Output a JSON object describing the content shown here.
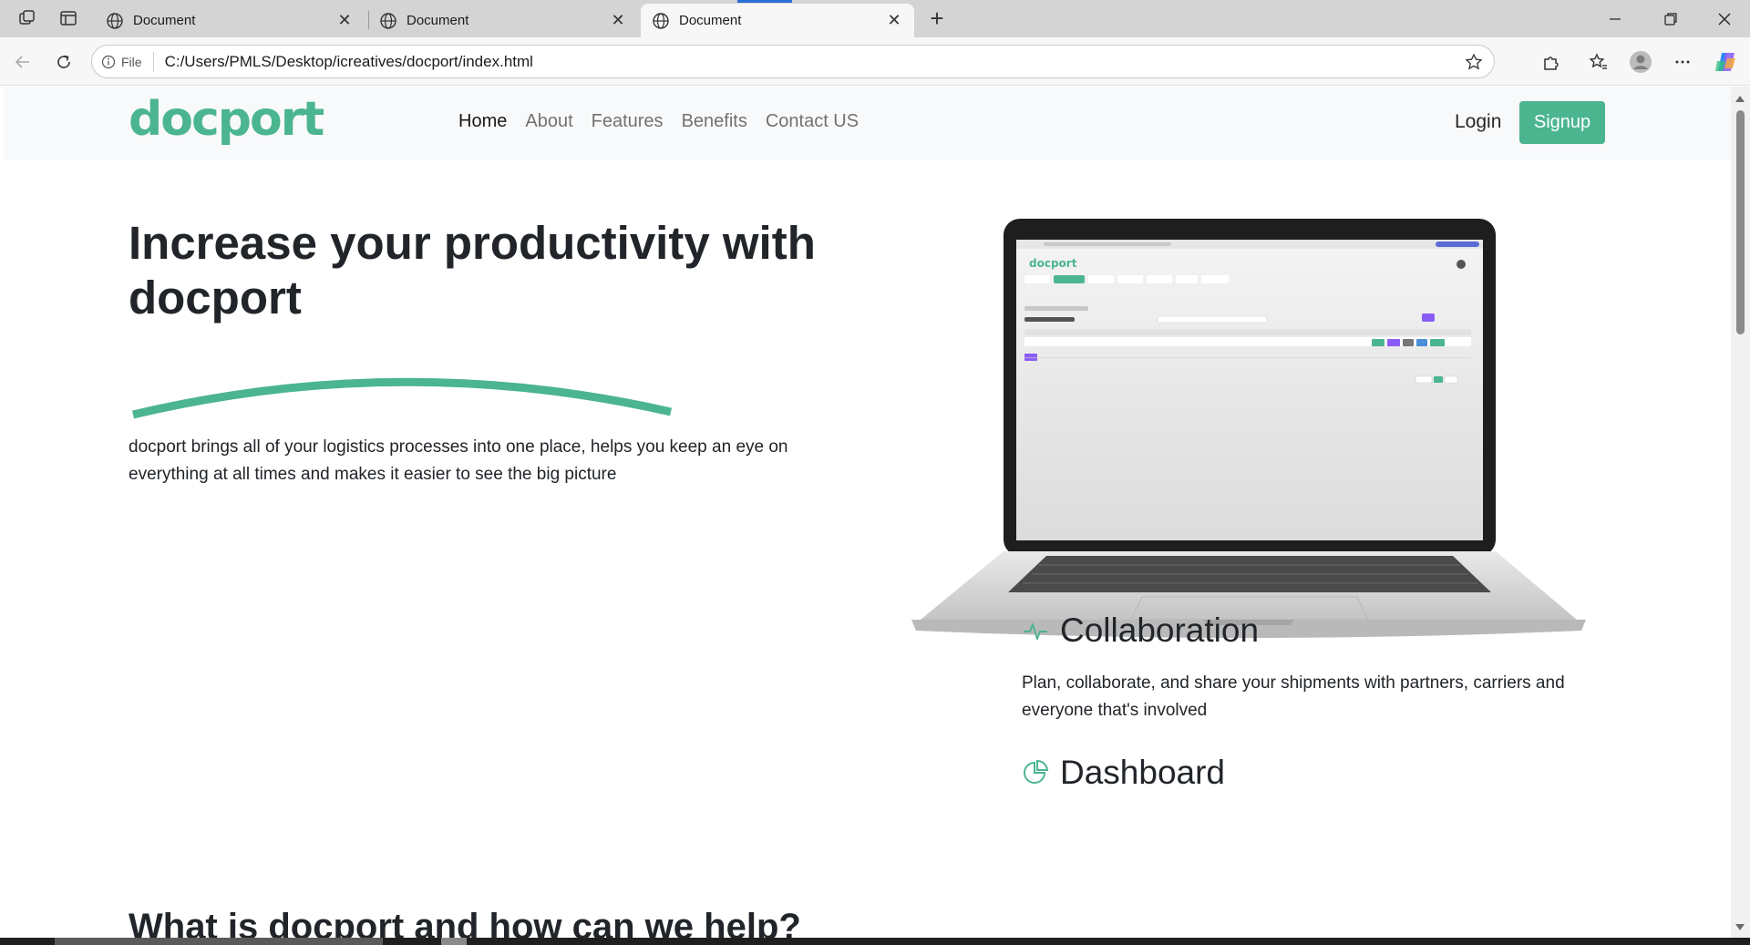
{
  "browser": {
    "tabs": [
      {
        "title": "Document",
        "active": false
      },
      {
        "title": "Document",
        "active": false
      },
      {
        "title": "Document",
        "active": true
      }
    ],
    "site_info_label": "File",
    "url": "C:/Users/PMLS/Desktop/icreatives/docport/index.html"
  },
  "navbar": {
    "logo": "docport",
    "menu": [
      {
        "label": "Home",
        "active": true
      },
      {
        "label": "About",
        "active": false
      },
      {
        "label": "Features",
        "active": false
      },
      {
        "label": "Benefits",
        "active": false
      },
      {
        "label": "Contact US",
        "active": false
      }
    ],
    "login_label": "Login",
    "signup_label": "Signup"
  },
  "hero": {
    "title_line1": "Increase your productivity with",
    "title_line2": "docport",
    "description": "docport brings all of your logistics processes into one place, helps you keep an eye on everything at all times and makes it easier to see the big picture"
  },
  "features": [
    {
      "icon": "activity-icon",
      "title": "Collaboration",
      "text": "Plan, collaborate, and share your shipments with partners, carriers and everyone that's involved"
    },
    {
      "icon": "pie-chart-icon",
      "title": "Dashboard",
      "text": ""
    }
  ],
  "section_title": "What is docport and how can we help?",
  "colors": {
    "brand": "#4bb58f",
    "navbar_bg": "#f8f9fa",
    "text": "#212529"
  }
}
